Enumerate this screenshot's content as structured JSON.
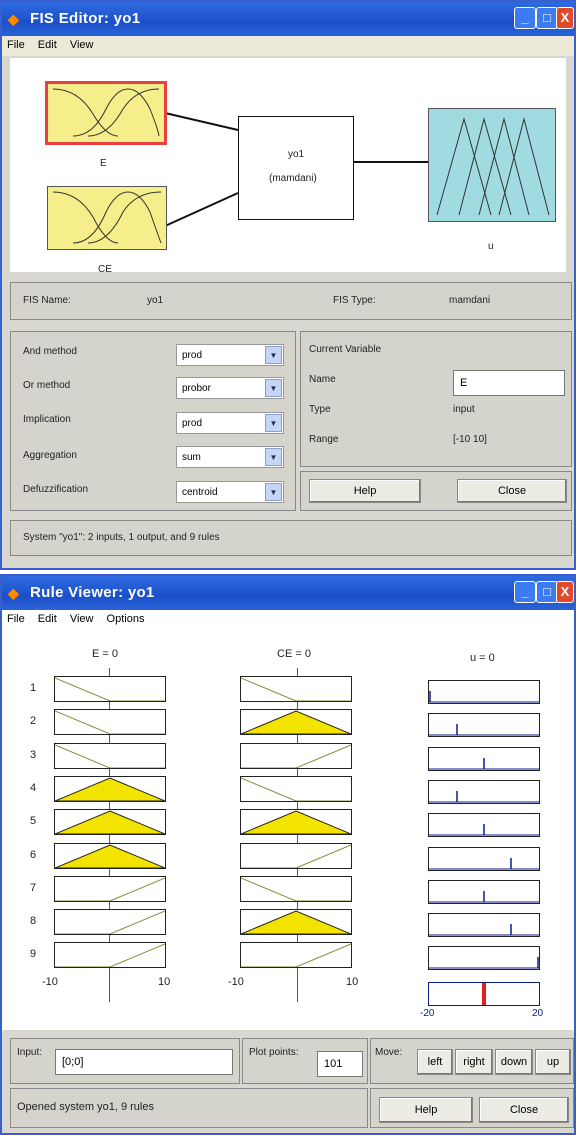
{
  "fis": {
    "title": "FIS Editor: yo1",
    "menu": [
      "File",
      "Edit",
      "View"
    ],
    "inputs": [
      "E",
      "CE"
    ],
    "system_name": "yo1",
    "system_type": "(mamdani)",
    "output": "u",
    "fis_name_label": "FIS Name:",
    "fis_name_value": "yo1",
    "fis_type_label": "FIS Type:",
    "fis_type_value": "mamdani",
    "methods": [
      {
        "label": "And method",
        "value": "prod"
      },
      {
        "label": "Or method",
        "value": "probor"
      },
      {
        "label": "Implication",
        "value": "prod"
      },
      {
        "label": "Aggregation",
        "value": "sum"
      },
      {
        "label": "Defuzzification",
        "value": "centroid"
      }
    ],
    "current_variable_label": "Current Variable",
    "name_label": "Name",
    "name_value": "E",
    "type_label": "Type",
    "type_value": "input",
    "range_label": "Range",
    "range_value": "[-10 10]",
    "help": "Help",
    "close": "Close",
    "status": "System \"yo1\": 2 inputs, 1 output, and 9 rules"
  },
  "rule": {
    "title": "Rule Viewer: yo1",
    "menu": [
      "File",
      "Edit",
      "View",
      "Options"
    ],
    "col_e": "E = 0",
    "col_ce": "CE = 0",
    "col_u": "u = 0",
    "rule_numbers": [
      "1",
      "2",
      "3",
      "4",
      "5",
      "6",
      "7",
      "8",
      "9"
    ],
    "e_axis": [
      "-10",
      "10"
    ],
    "ce_axis": [
      "-10",
      "10"
    ],
    "u_axis": [
      "-20",
      "20"
    ],
    "e_shapes": [
      "neg",
      "neg",
      "neg",
      "zero_fill",
      "zero_fill",
      "zero_fill",
      "pos",
      "pos",
      "pos"
    ],
    "ce_shapes": [
      "neg",
      "zero_fill",
      "pos",
      "neg",
      "zero_fill",
      "pos",
      "neg",
      "zero_fill",
      "pos"
    ],
    "u_spikes": [
      -20,
      -10,
      0,
      -10,
      0,
      10,
      0,
      10,
      20
    ],
    "u_result": 0,
    "input_label": "Input:",
    "input_value": "[0;0]",
    "plot_points_label": "Plot points:",
    "plot_points_value": "101",
    "move_label": "Move:",
    "move_buttons": [
      "left",
      "right",
      "down",
      "up"
    ],
    "status": "Opened system yo1, 9 rules",
    "help": "Help",
    "close": "Close"
  },
  "colors": {
    "input_fill": "#f5ee8a",
    "output_fill": "#9fdbe0",
    "mf_fill": "#f2e400",
    "redline": "#e02020",
    "spike": "#0a1c8c"
  }
}
